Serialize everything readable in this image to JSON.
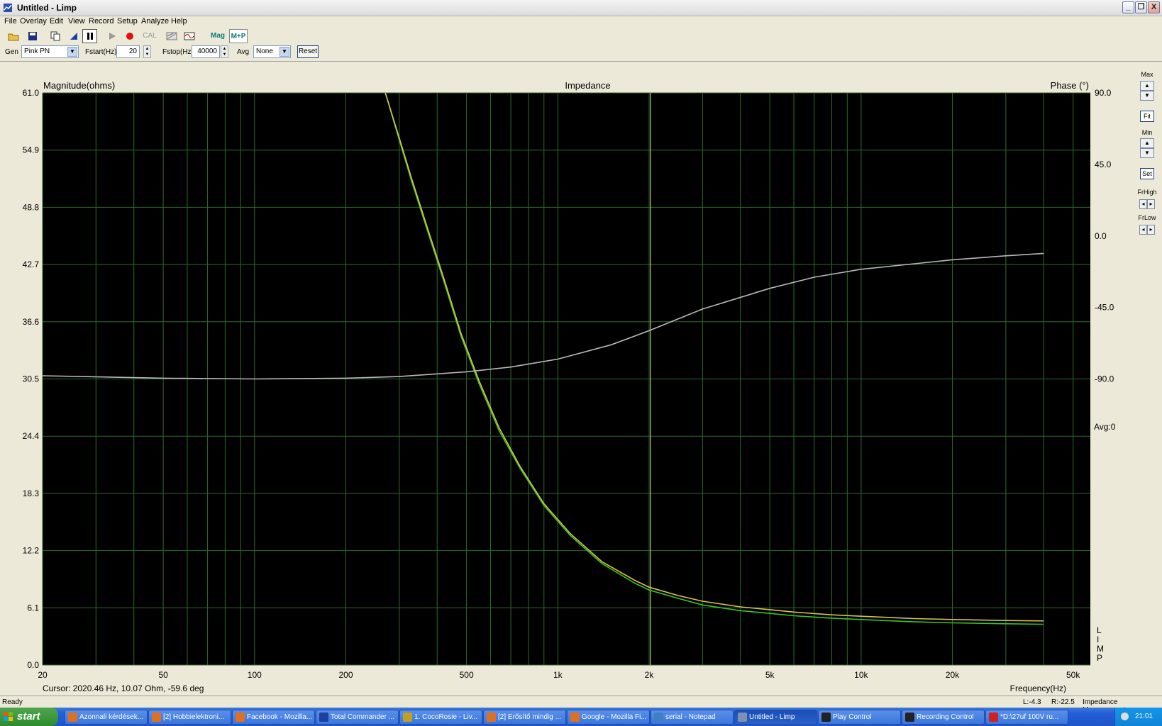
{
  "window": {
    "title": "Untitled - Limp",
    "min": "_",
    "restore": "❐",
    "close": "X"
  },
  "menu": [
    "File",
    "Overlay",
    "Edit",
    "View",
    "Record",
    "Setup",
    "Analyze",
    "Help"
  ],
  "toolbar": {
    "cal": "CAL",
    "mag": "Mag",
    "mp": "M+P"
  },
  "controls": {
    "gen_label": "Gen",
    "gen_value": "Pink PN",
    "fstart_label": "Fstart(Hz)",
    "fstart_value": "20",
    "fstop_label": "Fstop(Hz)",
    "fstop_value": "40000",
    "avg_label": "Avg",
    "avg_value": "None",
    "reset_label": "Reset"
  },
  "right_panel": {
    "max": "Max",
    "fit": "Fit",
    "min": "Min",
    "set": "Set",
    "frhigh": "FrHigh",
    "frlow": "FrLow"
  },
  "chart_data": {
    "type": "line",
    "title": "Impedance",
    "ylabel": "Magnitude(ohms)",
    "y2label": "Phase (°)",
    "xlabel": "Frequency(Hz)",
    "xscale": "log",
    "xlim": [
      20,
      57000
    ],
    "ylim": [
      0,
      61
    ],
    "y2lim": [
      -270,
      90
    ],
    "y_ticks": [
      "0.0",
      "6.1",
      "12.2",
      "18.3",
      "24.4",
      "30.5",
      "36.6",
      "42.7",
      "48.8",
      "54.9",
      "61.0"
    ],
    "y2_ticks": [
      "90.0",
      "45.0",
      "0.0",
      "-45.0",
      "-90.0"
    ],
    "x_ticks": [
      {
        "v": 20,
        "l": "20"
      },
      {
        "v": 50,
        "l": "50"
      },
      {
        "v": 100,
        "l": "100"
      },
      {
        "v": 200,
        "l": "200"
      },
      {
        "v": 500,
        "l": "500"
      },
      {
        "v": 1000,
        "l": "1k"
      },
      {
        "v": 2000,
        "l": "2k"
      },
      {
        "v": 5000,
        "l": "5k"
      },
      {
        "v": 10000,
        "l": "10k"
      },
      {
        "v": 20000,
        "l": "20k"
      },
      {
        "v": 50000,
        "l": "50k"
      }
    ],
    "grid": true,
    "avg_text": "Avg:0",
    "watermark": "LIMP",
    "cursor_x": 2020.46,
    "cursor_text": "Cursor: 2020.46 Hz, 10.07 Ohm, -59.6 deg",
    "series": [
      {
        "color": "#39c51b",
        "x": [
          270,
          300,
          330,
          370,
          420,
          480,
          550,
          640,
          750,
          900,
          1100,
          1400,
          1800,
          2000,
          2500,
          3000,
          4000,
          5000,
          6000,
          8000,
          10000,
          15000,
          20000,
          30000,
          40000
        ],
        "y": [
          61.0,
          56.0,
          51.5,
          46.5,
          41.0,
          35.0,
          30.0,
          25.0,
          21.0,
          17.0,
          13.8,
          10.8,
          8.7,
          8.0,
          7.1,
          6.4,
          5.8,
          5.5,
          5.25,
          5.0,
          4.85,
          4.6,
          4.5,
          4.4,
          4.35
        ]
      },
      {
        "color": "#d8c24a",
        "x": [
          270,
          300,
          330,
          370,
          420,
          480,
          550,
          640,
          750,
          900,
          1100,
          1400,
          1800,
          2000,
          2500,
          3000,
          4000,
          5000,
          6000,
          8000,
          10000,
          15000,
          20000,
          30000,
          40000
        ],
        "y": [
          61.0,
          56.2,
          51.8,
          46.8,
          41.3,
          35.3,
          30.3,
          25.3,
          21.2,
          17.2,
          14.0,
          11.0,
          9.0,
          8.3,
          7.4,
          6.8,
          6.2,
          5.9,
          5.65,
          5.35,
          5.2,
          4.95,
          4.85,
          4.75,
          4.7
        ]
      },
      {
        "color": "#b8b8b8",
        "axis": "right",
        "x": [
          20,
          50,
          100,
          200,
          300,
          500,
          700,
          1000,
          1500,
          2000,
          3000,
          5000,
          7000,
          10000,
          15000,
          20000,
          30000,
          40000
        ],
        "y": [
          -88.0,
          -89.5,
          -90.0,
          -89.5,
          -88.5,
          -85.5,
          -82.5,
          -77.5,
          -68.5,
          -59.6,
          -46.0,
          -33.0,
          -26.0,
          -21.0,
          -17.5,
          -15.0,
          -12.5,
          -11.0
        ]
      }
    ]
  },
  "status": {
    "left": "Ready",
    "l": "L:-4.3",
    "r": "R:-22.5",
    "mode": "Impedance Measurement"
  },
  "taskbar": {
    "start": "start",
    "tasks": [
      "Azonnali kérdések...",
      "[2] Hobbielektroni...",
      "Facebook - Mozilla...",
      "Total Commander ...",
      "1. CocoRosie - Liv...",
      "[2] Erősítő mindig ...",
      "Google - Mozilla Fi...",
      "serial - Notepad",
      "Untitled - Limp",
      "Play Control",
      "Recording Control",
      "*D:\\27uf 100V ru..."
    ],
    "clock": "21:01"
  }
}
